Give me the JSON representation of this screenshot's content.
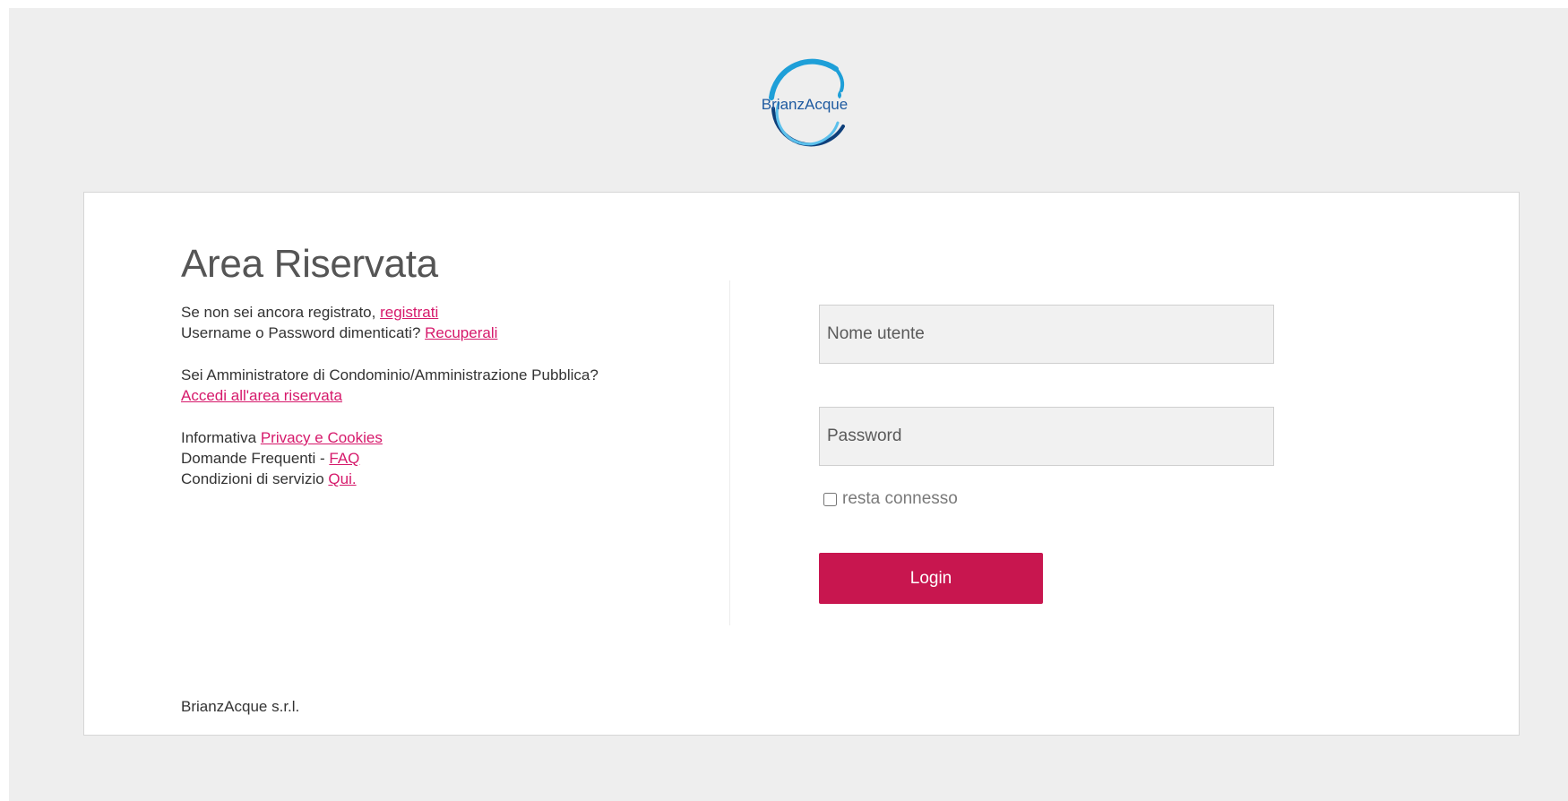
{
  "brand": {
    "logo_text": "BrianzAcque",
    "logo_colors": {
      "ring": "#1e9fd8",
      "ring_dark": "#0e3f7a",
      "text": "#1e5aa0"
    }
  },
  "main": {
    "title": "Area Riservata",
    "register_prefix": "Se non sei ancora registrato, ",
    "register_link": "registrati",
    "recover_prefix": "Username o Password dimenticati? ",
    "recover_link": "Recuperali",
    "admin_question": "Sei Amministratore di Condominio/Amministrazione Pubblica?",
    "admin_link": "Accedi all'area riservata",
    "privacy_prefix": "Informativa ",
    "privacy_link": "Privacy e Cookies",
    "faq_prefix": "Domande Frequenti - ",
    "faq_link": "FAQ",
    "terms_prefix": "Condizioni di servizio ",
    "terms_link": "Qui."
  },
  "form": {
    "username_placeholder": "Nome utente",
    "username_value": "",
    "password_placeholder": "Password",
    "password_value": "",
    "remember_label": "resta connesso",
    "remember_checked": false,
    "login_label": "Login"
  },
  "footer": {
    "company": "BrianzAcque s.r.l."
  },
  "colors": {
    "accent": "#c8164f",
    "link": "#d6196b",
    "background": "#eeeeee",
    "card": "#ffffff"
  }
}
